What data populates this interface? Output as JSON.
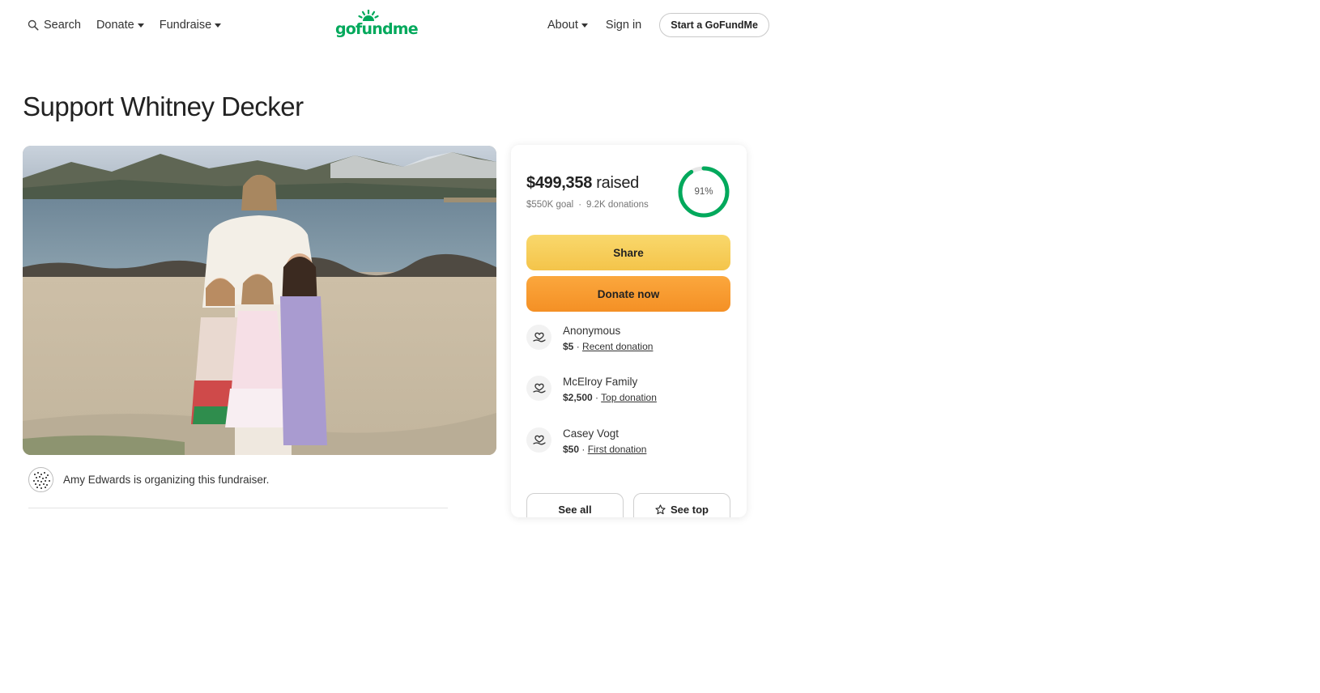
{
  "header": {
    "search_label": "Search",
    "donate_label": "Donate",
    "fundraise_label": "Fundraise",
    "logo_text": "gofundme",
    "about_label": "About",
    "signin_label": "Sign in",
    "start_label": "Start a GoFundMe"
  },
  "page": {
    "title": "Support Whitney Decker"
  },
  "organizer": {
    "text": "Amy Edwards is organizing this fundraiser."
  },
  "card": {
    "raised_amount": "$499,358",
    "raised_suffix": " raised",
    "goal": "$550K goal",
    "separator": "·",
    "donations": "9.2K donations",
    "progress_label": "91%",
    "progress_fraction": 0.91,
    "share_label": "Share",
    "donate_label": "Donate now",
    "see_all_label": "See all",
    "see_top_label": "See top"
  },
  "donors": [
    {
      "name": "Anonymous",
      "amount": "$5",
      "sep": " · ",
      "tag": "Recent donation"
    },
    {
      "name": "McElroy Family",
      "amount": "$2,500",
      "sep": " · ",
      "tag": "Top donation"
    },
    {
      "name": "Casey Vogt",
      "amount": "$50",
      "sep": " · ",
      "tag": "First donation"
    }
  ],
  "colors": {
    "brand_green": "#02a95c",
    "share_yellow": "#f4c44a",
    "donate_orange": "#f49025"
  }
}
